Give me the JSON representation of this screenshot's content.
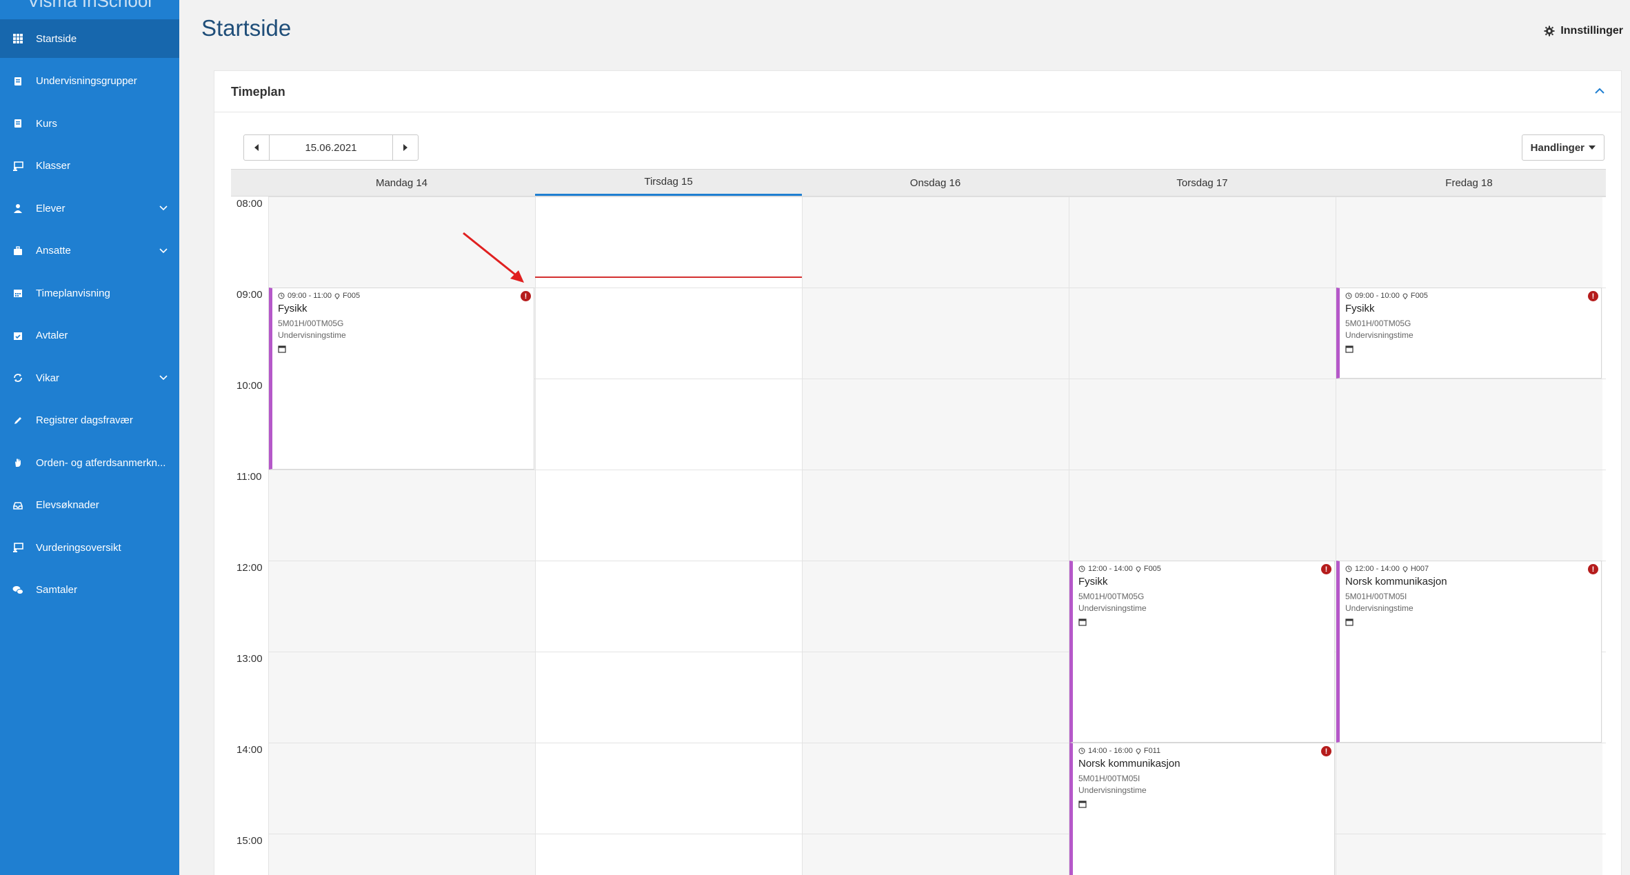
{
  "app": {
    "brand": "Visma InSchool"
  },
  "sidebar": {
    "items": [
      {
        "label": "Startside",
        "icon": "grid-icon",
        "active": true,
        "expandable": false
      },
      {
        "label": "Undervisningsgrupper",
        "icon": "book-icon",
        "expandable": false
      },
      {
        "label": "Kurs",
        "icon": "book-icon",
        "expandable": false
      },
      {
        "label": "Klasser",
        "icon": "chalkboard-icon",
        "expandable": false
      },
      {
        "label": "Elever",
        "icon": "student-icon",
        "expandable": true
      },
      {
        "label": "Ansatte",
        "icon": "briefcase-icon",
        "expandable": true
      },
      {
        "label": "Timeplanvisning",
        "icon": "calendar-icon",
        "expandable": false
      },
      {
        "label": "Avtaler",
        "icon": "calendar-check-icon",
        "expandable": false
      },
      {
        "label": "Vikar",
        "icon": "refresh-icon",
        "expandable": true
      },
      {
        "label": "Registrer dagsfravær",
        "icon": "pencil-icon",
        "expandable": false
      },
      {
        "label": "Orden- og atferdsanmerkn...",
        "icon": "hand-icon",
        "expandable": false
      },
      {
        "label": "Elevsøknader",
        "icon": "inbox-icon",
        "expandable": false
      },
      {
        "label": "Vurderingsoversikt",
        "icon": "chalkboard-icon",
        "expandable": false
      },
      {
        "label": "Samtaler",
        "icon": "chat-icon",
        "expandable": false
      }
    ]
  },
  "header": {
    "title": "Startside",
    "settings_label": "Innstillinger"
  },
  "timetable": {
    "title": "Timeplan",
    "date": "15.06.2021",
    "actions_label": "Handlinger",
    "days": [
      {
        "label": "Mandag 14",
        "today": false
      },
      {
        "label": "Tirsdag 15",
        "today": true
      },
      {
        "label": "Onsdag 16",
        "today": false
      },
      {
        "label": "Torsdag 17",
        "today": false
      },
      {
        "label": "Fredag 18",
        "today": false
      }
    ],
    "hours": [
      "08:00",
      "09:00",
      "10:00",
      "11:00",
      "12:00",
      "13:00",
      "14:00",
      "15:00"
    ],
    "now": "09:00",
    "events": [
      {
        "day": 0,
        "start": "09:00",
        "end": "11:00",
        "time": "09:00 - 11:00",
        "room": "F005",
        "title": "Fysikk",
        "group": "5M01H/00TM05G",
        "type": "Undervisningstime",
        "alert": true,
        "accent": "#b558c9"
      },
      {
        "day": 4,
        "start": "09:00",
        "end": "10:00",
        "time": "09:00 - 10:00",
        "room": "F005",
        "title": "Fysikk",
        "group": "5M01H/00TM05G",
        "type": "Undervisningstime",
        "alert": true,
        "accent": "#b558c9"
      },
      {
        "day": 3,
        "start": "12:00",
        "end": "14:00",
        "time": "12:00 - 14:00",
        "room": "F005",
        "title": "Fysikk",
        "group": "5M01H/00TM05G",
        "type": "Undervisningstime",
        "alert": true,
        "accent": "#b558c9"
      },
      {
        "day": 4,
        "start": "12:00",
        "end": "14:00",
        "time": "12:00 - 14:00",
        "room": "H007",
        "title": "Norsk kommunikasjon",
        "group": "5M01H/00TM05I",
        "type": "Undervisningstime",
        "alert": true,
        "accent": "#b558c9"
      },
      {
        "day": 3,
        "start": "14:00",
        "end": "16:00",
        "time": "14:00 - 16:00",
        "room": "F011",
        "title": "Norsk kommunikasjon",
        "group": "5M01H/00TM05I",
        "type": "Undervisningstime",
        "alert": true,
        "accent": "#b558c9"
      }
    ]
  },
  "annotation": {
    "arrow_color": "#e02020"
  }
}
